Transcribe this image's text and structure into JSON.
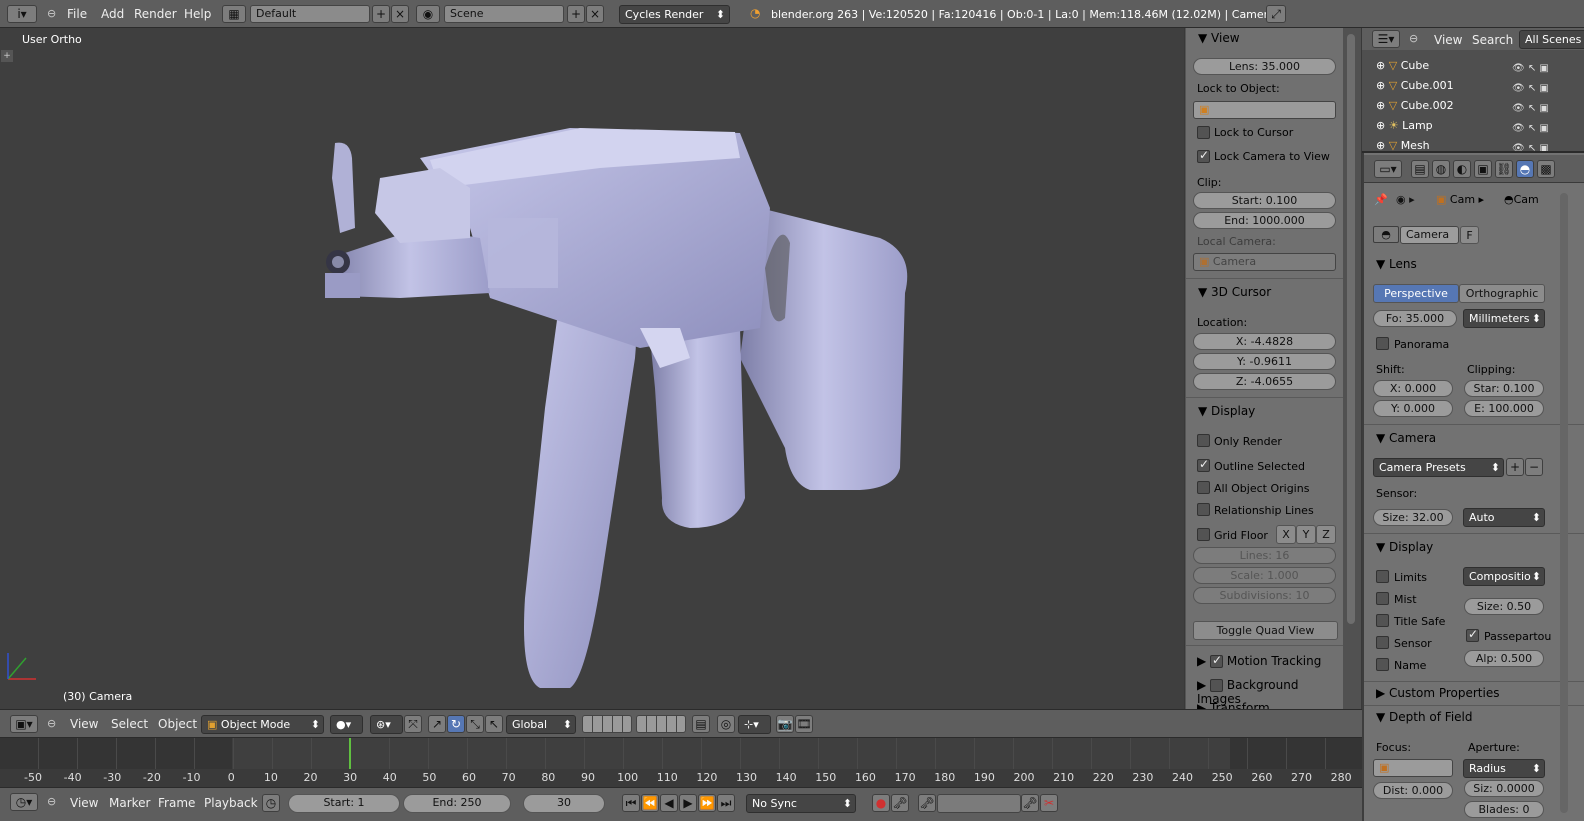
{
  "top": {
    "menus": [
      "File",
      "Add",
      "Render",
      "Help"
    ],
    "screen": "Default",
    "scene": "Scene",
    "engine": "Cycles Render",
    "stats": "blender.org 263 | Ve:120520 | Fa:120416 | Ob:0-1 | La:0 | Mem:118.46M (12.02M) | Camera"
  },
  "viewport": {
    "view_label": "User Ortho",
    "object_label": "(30) Camera"
  },
  "npanel": {
    "view_title": "View",
    "lens": "Lens: 35.000",
    "lock_object": "Lock to Object:",
    "lock_cursor": "Lock to Cursor",
    "lock_camera": "Lock Camera to View",
    "clip": "Clip:",
    "clip_start": "Start: 0.100",
    "clip_end": "End: 1000.000",
    "local_camera": "Local Camera:",
    "local_camera_field": "Camera",
    "cursor_title": "3D Cursor",
    "location": "Location:",
    "x": "X: -4.4828",
    "y": "Y: -0.9611",
    "z": "Z: -4.0655",
    "display_title": "Display",
    "only_render": "Only Render",
    "outline_selected": "Outline Selected",
    "all_origins": "All Object Origins",
    "relationship": "Relationship Lines",
    "grid_floor": "Grid Floor",
    "axis_x": "X",
    "axis_y": "Y",
    "axis_z": "Z",
    "lines": "Lines: 16",
    "scale": "Scale: 1.000",
    "subdivisions": "Subdivisions: 10",
    "toggle_quad": "Toggle Quad View",
    "motion_tracking": "Motion Tracking",
    "background_images": "Background Images",
    "transform_orientations": "Transform Orientations"
  },
  "outliner": {
    "view": "View",
    "search": "Search",
    "filter": "All Scenes",
    "rows": [
      "Cube",
      "Cube.001",
      "Cube.002",
      "Lamp",
      "Mesh"
    ]
  },
  "properties": {
    "breadcrumb_1": "Cam",
    "breadcrumb_2": "Cam",
    "datablock": "Camera",
    "fake": "F",
    "lens_title": "Lens",
    "perspective": "Perspective",
    "orthographic": "Orthographic",
    "focal": "Fo: 35.000",
    "units": "Millimeters",
    "panorama": "Panorama",
    "shift": "Shift:",
    "clipping": "Clipping:",
    "shift_x": "X: 0.000",
    "shift_y": "Y: 0.000",
    "clip_start": "Star: 0.100",
    "clip_end": "E: 100.000",
    "camera_title": "Camera",
    "presets": "Camera Presets",
    "sensor": "Sensor:",
    "sensor_size": "Size: 32.00",
    "sensor_fit": "Auto",
    "display_title": "Display",
    "limits": "Limits",
    "composition": "Compositio",
    "mist": "Mist",
    "size": "Size: 0.50",
    "title_safe": "Title Safe",
    "passepartout": "Passepartou",
    "sensor_cb": "Sensor",
    "alpha": "Alp: 0.500",
    "name": "Name",
    "custom_props": "Custom Properties",
    "dof_title": "Depth of Field",
    "focus": "Focus:",
    "aperture": "Aperture:",
    "aperture_type": "Radius",
    "distance": "Dist: 0.000",
    "dof_size": "Siz: 0.0000",
    "blades": "Blades: 0"
  },
  "header3d": {
    "view": "View",
    "select": "Select",
    "object": "Object",
    "mode": "Object Mode",
    "orientation": "Global"
  },
  "timeline": {
    "ticks": [
      "-50",
      "-40",
      "-30",
      "-20",
      "-10",
      "0",
      "10",
      "20",
      "30",
      "40",
      "50",
      "60",
      "70",
      "80",
      "90",
      "100",
      "110",
      "120",
      "130",
      "140",
      "150",
      "160",
      "170",
      "180",
      "190",
      "200",
      "210",
      "220",
      "230",
      "240",
      "250",
      "260",
      "270",
      "280"
    ],
    "current_frame": 30
  },
  "timelinebar": {
    "view": "View",
    "marker": "Marker",
    "frame": "Frame",
    "playback": "Playback",
    "start": "Start: 1",
    "end": "End: 250",
    "current": "30",
    "sync": "No Sync"
  }
}
